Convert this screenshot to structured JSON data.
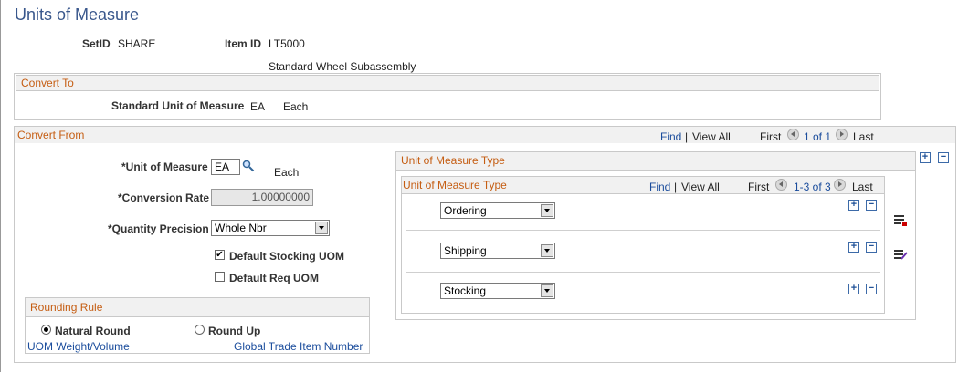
{
  "page": {
    "title": "Units of Measure"
  },
  "header": {
    "setid_label": "SetID",
    "setid_value": "SHARE",
    "itemid_label": "Item ID",
    "itemid_value": "LT5000",
    "item_description": "Standard Wheel Subassembly"
  },
  "convert_to": {
    "title": "Convert To",
    "std_uom_label": "Standard Unit of Measure",
    "std_uom_code": "EA",
    "std_uom_desc": "Each"
  },
  "convert_from": {
    "title": "Convert From",
    "find": "Find",
    "view_all": "View All",
    "first": "First",
    "pager": "1 of 1",
    "last": "Last",
    "uom_label": "*Unit of Measure",
    "uom_value": "EA",
    "uom_desc": "Each",
    "rate_label": "*Conversion Rate",
    "rate_value": "1.00000000",
    "precision_label": "*Quantity Precision",
    "precision_value": "Whole Nbr",
    "default_stocking_label": "Default Stocking UOM",
    "default_stocking_checked": "✔",
    "default_req_label": "Default Req UOM"
  },
  "rounding": {
    "title": "Rounding Rule",
    "natural_label": "Natural Round",
    "roundup_label": "Round Up",
    "uom_weight_link": "UOM Weight/Volume",
    "gtin_link": "Global Trade Item Number"
  },
  "uom_type_outer": {
    "title": "Unit of Measure Type"
  },
  "uom_type_grid": {
    "title": "Unit of Measure Type",
    "find": "Find",
    "view_all": "View All",
    "first": "First",
    "pager": "1-3 of 3",
    "last": "Last",
    "rows": [
      {
        "value": "Ordering"
      },
      {
        "value": "Shipping"
      },
      {
        "value": "Stocking"
      }
    ]
  },
  "icons": {
    "plus": "+",
    "minus": "−"
  }
}
